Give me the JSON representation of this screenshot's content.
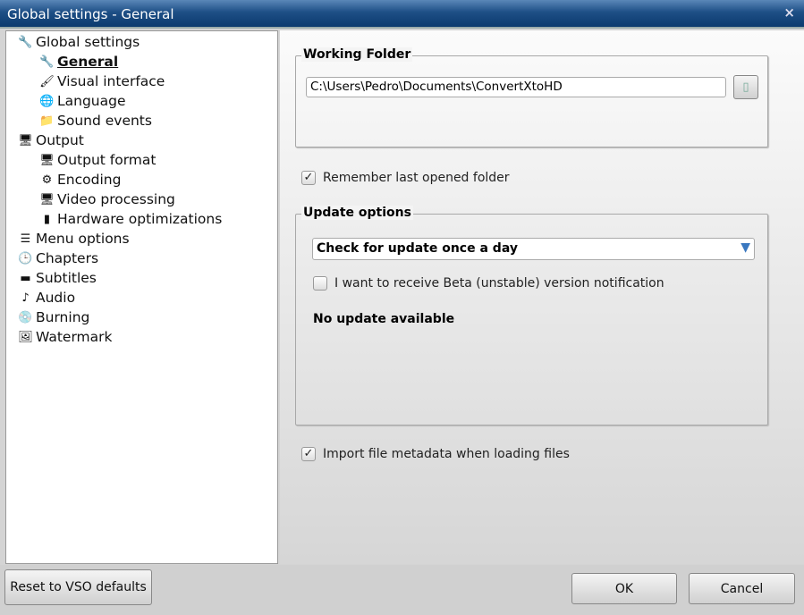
{
  "window": {
    "title": "Global settings - General",
    "close": "×"
  },
  "tree": [
    {
      "label": "Global settings",
      "icon": "wrench-icon",
      "glyph": "🔧",
      "level": 0
    },
    {
      "label": "General",
      "icon": "wrench-icon",
      "glyph": "🔧",
      "level": 1,
      "selected": true
    },
    {
      "label": "Visual interface",
      "icon": "paint-icon",
      "glyph": "🖌",
      "level": 1
    },
    {
      "label": "Language",
      "icon": "globe-icon",
      "glyph": "🌐",
      "level": 1
    },
    {
      "label": "Sound events",
      "icon": "music-folder-icon",
      "glyph": "📁",
      "level": 1
    },
    {
      "label": "Output",
      "icon": "monitor-icon",
      "glyph": "🖥",
      "level": 0
    },
    {
      "label": "Output format",
      "icon": "monitor-icon",
      "glyph": "🖥",
      "level": 1
    },
    {
      "label": "Encoding",
      "icon": "gear-icon",
      "glyph": "⚙",
      "level": 1
    },
    {
      "label": "Video processing",
      "icon": "monitor-gear-icon",
      "glyph": "🖥",
      "level": 1
    },
    {
      "label": "Hardware optimizations",
      "icon": "chip-icon",
      "glyph": "▮",
      "level": 1
    },
    {
      "label": "Menu options",
      "icon": "menu-icon",
      "glyph": "☰",
      "level": 0
    },
    {
      "label": "Chapters",
      "icon": "clock-icon",
      "glyph": "🕒",
      "level": 0
    },
    {
      "label": "Subtitles",
      "icon": "subtitle-icon",
      "glyph": "▬",
      "level": 0
    },
    {
      "label": "Audio",
      "icon": "music-note-icon",
      "glyph": "♪",
      "level": 0
    },
    {
      "label": "Burning",
      "icon": "disc-icon",
      "glyph": "💿",
      "level": 0
    },
    {
      "label": "Watermark",
      "icon": "image-icon",
      "glyph": "🖼",
      "level": 0
    }
  ],
  "working_folder": {
    "title": "Working Folder",
    "path": "C:\\Users\\Pedro\\Documents\\ConvertXtoHD"
  },
  "remember_folder": {
    "label": "Remember last opened folder",
    "checked": true
  },
  "update": {
    "title": "Update options",
    "frequency": "Check for update once a day",
    "beta_label": "I want to receive Beta (unstable) version notification",
    "beta_checked": false,
    "status": "No update available"
  },
  "import_metadata": {
    "label": "Import file metadata when loading files",
    "checked": true
  },
  "buttons": {
    "reset": "Reset to VSO defaults",
    "ok": "OK",
    "cancel": "Cancel"
  },
  "colors": {
    "title_bar": "#1e4f86",
    "accent_arrow": "#3a78c0"
  }
}
